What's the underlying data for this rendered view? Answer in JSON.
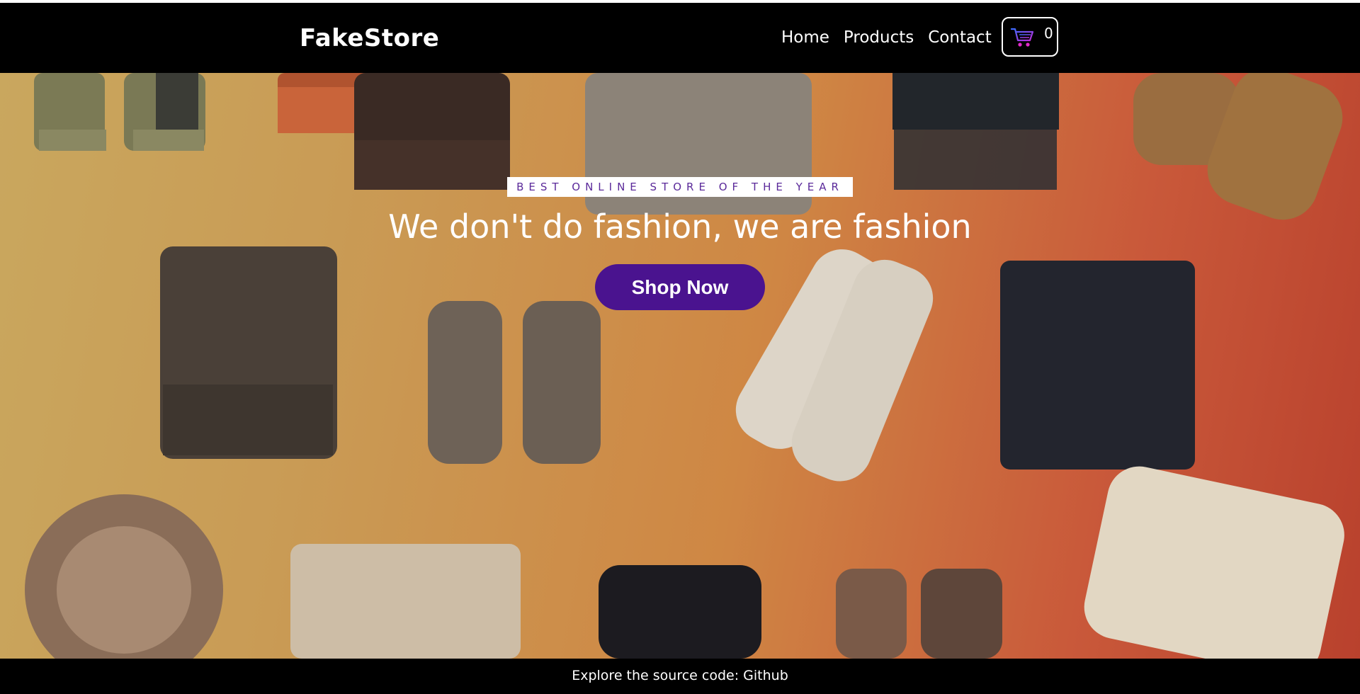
{
  "header": {
    "brand": "FakeStore",
    "nav": [
      {
        "label": "Home"
      },
      {
        "label": "Products"
      },
      {
        "label": "Contact"
      }
    ],
    "cart": {
      "icon": "shopping-cart-icon",
      "count": "0"
    }
  },
  "hero": {
    "tagline": "BEST ONLINE STORE OF THE YEAR",
    "headline": "We don't do fashion, we are fashion",
    "cta_label": "Shop Now",
    "background_image": "flat-lay winter accessories (hats, scarves, gloves, socks) on a yellow-to-orange gradient"
  },
  "footer": {
    "text": "Explore the source code: ",
    "link_label": "Github"
  },
  "colors": {
    "header_bg": "#000000",
    "accent_purple": "#4a138f",
    "tagline_text": "#5b2a9a",
    "hero_gradient_start": "#c9a75e",
    "hero_gradient_end": "#b9412d"
  }
}
